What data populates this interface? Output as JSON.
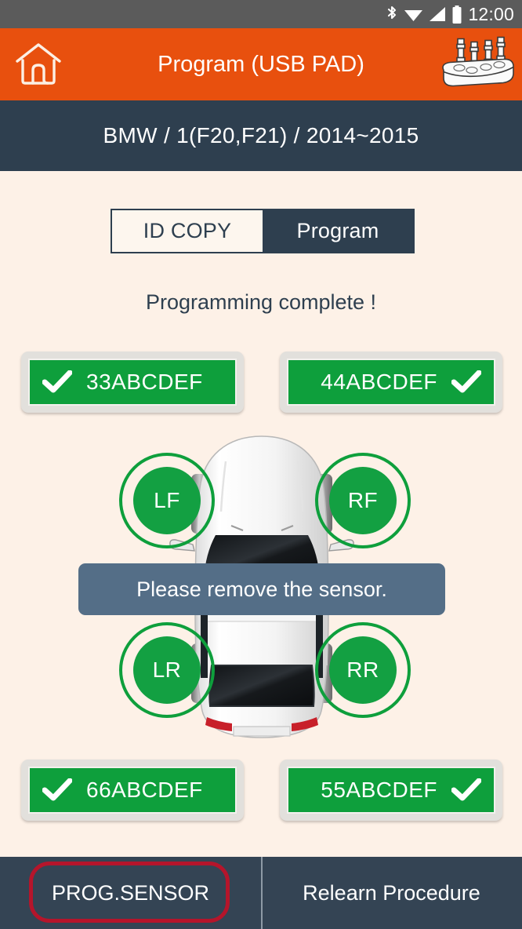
{
  "statusbar": {
    "time": "12:00",
    "icons": [
      "bluetooth-icon",
      "wifi-icon",
      "signal-icon",
      "battery-icon"
    ]
  },
  "header": {
    "title": "Program (USB PAD)",
    "home_icon": "home-icon",
    "device_icon": "usb-pad-device-icon",
    "background_color": "#E8500E"
  },
  "breadcrumb": {
    "text": "BMW / 1(F20,F21) / 2014~2015",
    "background_color": "#2E3F4F"
  },
  "tabs": {
    "id_copy_label": "ID COPY",
    "program_label": "Program",
    "selected": "Program"
  },
  "status_message": "Programming complete !",
  "toast": {
    "message": "Please remove the sensor.",
    "background_color": "#546E87"
  },
  "wheels": [
    {
      "position": "LF",
      "sensor_id": "33ABCDEF",
      "status_icon": "check-icon",
      "color": "#13A042"
    },
    {
      "position": "RF",
      "sensor_id": "44ABCDEF",
      "status_icon": "check-icon",
      "color": "#13A042"
    },
    {
      "position": "LR",
      "sensor_id": "66ABCDEF",
      "status_icon": "check-icon",
      "color": "#13A042"
    },
    {
      "position": "RR",
      "sensor_id": "55ABCDEF",
      "status_icon": "check-icon",
      "color": "#13A042"
    }
  ],
  "bottom_bar": {
    "prog_sensor_label": "PROG.SENSOR",
    "relearn_label": "Relearn Procedure",
    "highlight_color": "#B5152B",
    "background_color": "#344454"
  }
}
